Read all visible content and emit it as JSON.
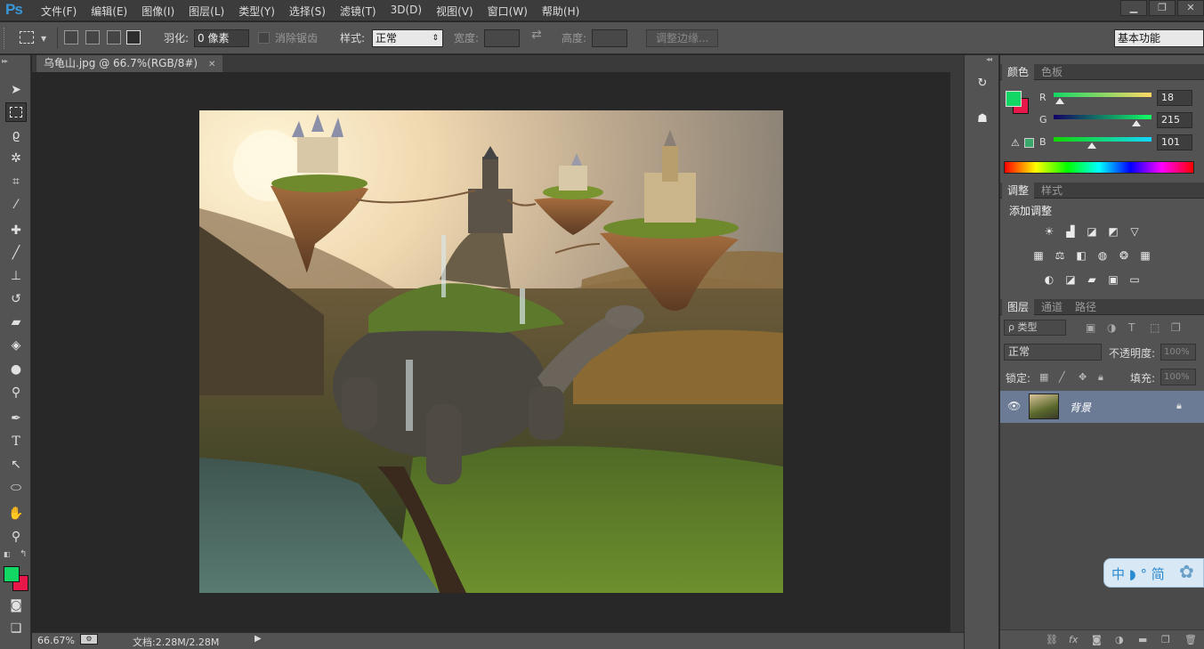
{
  "app": {
    "logo": "Ps"
  },
  "menu": [
    "文件(F)",
    "编辑(E)",
    "图像(I)",
    "图层(L)",
    "类型(Y)",
    "选择(S)",
    "滤镜(T)",
    "3D(D)",
    "视图(V)",
    "窗口(W)",
    "帮助(H)"
  ],
  "options": {
    "feather_label": "羽化:",
    "feather_value": "0 像素",
    "antialias_label": "消除锯齿",
    "style_label": "样式:",
    "style_value": "正常",
    "width_label": "宽度:",
    "height_label": "高度:",
    "refine_button": "调整边缘...",
    "workspace": "基本功能"
  },
  "document": {
    "tab_title": "乌龟山.jpg @ 66.7%(RGB/8#)",
    "zoom": "66.67%",
    "doc_size": "文档:2.28M/2.28M"
  },
  "color_panel": {
    "tab_color": "颜色",
    "tab_swatches": "色板",
    "r_label": "R",
    "g_label": "G",
    "b_label": "B",
    "r": "18",
    "g": "215",
    "b": "101",
    "foreground": "#12d765",
    "background": "#e8174a"
  },
  "adjust_panel": {
    "tab_adjust": "调整",
    "tab_styles": "样式",
    "title": "添加调整"
  },
  "layers_panel": {
    "tab_layers": "图层",
    "tab_channels": "通道",
    "tab_paths": "路径",
    "filter_kind": "ρ 类型",
    "blend_mode": "正常",
    "opacity_label": "不透明度:",
    "opacity_value": "100%",
    "lock_label": "锁定:",
    "fill_label": "填充:",
    "fill_value": "100%",
    "layers": [
      {
        "name": "背景",
        "visible": true,
        "locked": true
      }
    ]
  },
  "ime": {
    "text": "中 ◗ ° 简"
  }
}
